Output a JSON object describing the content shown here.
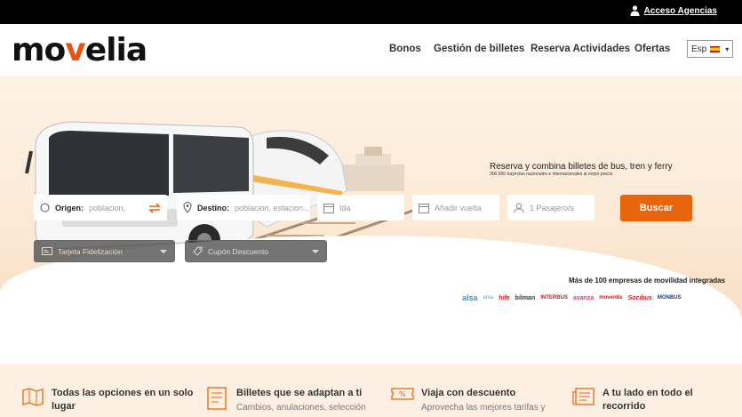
{
  "topbar": {
    "agency_label": "Acceso Agencias"
  },
  "header": {
    "nav": [
      "Bonos",
      "Gestión de billetes",
      "Reserva Actividades",
      "Ofertas"
    ],
    "lang": "Esp"
  },
  "hero": {
    "tagline": "Reserva y combina billetes de bus, tren y ferry",
    "subtagline": "300.000 trayectos nacionales e internacionales al mejor precio"
  },
  "search": {
    "origin_label": "Origen:",
    "origin_placeholder": "poblacion,",
    "destination_label": "Destino:",
    "destination_placeholder": "poblacion, estacion...",
    "ida": "Ida",
    "vuelta": "Añadir vuelta",
    "passengers": "1 Pasajero/s",
    "button": "Buscar",
    "loyalty": "Tarjeta Fidelización",
    "coupon": "Cupón Descuento"
  },
  "partners": {
    "title": "Más de 100 empresas de movilidad integradas",
    "names": [
      "alsa",
      "alsa",
      "hife",
      "bilman",
      "INTERBUS",
      "avanza",
      "moventis",
      "Socibus",
      "MONBUS"
    ]
  },
  "features": [
    {
      "title_1": "Todas las opciones en un solo",
      "title_2": "lugar",
      "desc": ""
    },
    {
      "title_1": "Billetes que se adaptan a ti",
      "title_2": "",
      "desc": "Cambios, anulaciones, selección"
    },
    {
      "title_1": "Viaja con descuento",
      "title_2": "",
      "desc": "Aprovecha las mejores tarifas y"
    },
    {
      "title_1": "A tu lado en todo el",
      "title_2": "recorrido",
      "desc": ""
    }
  ],
  "colors": {
    "accent": "#e9650d",
    "logo_v": "#e9530d"
  }
}
